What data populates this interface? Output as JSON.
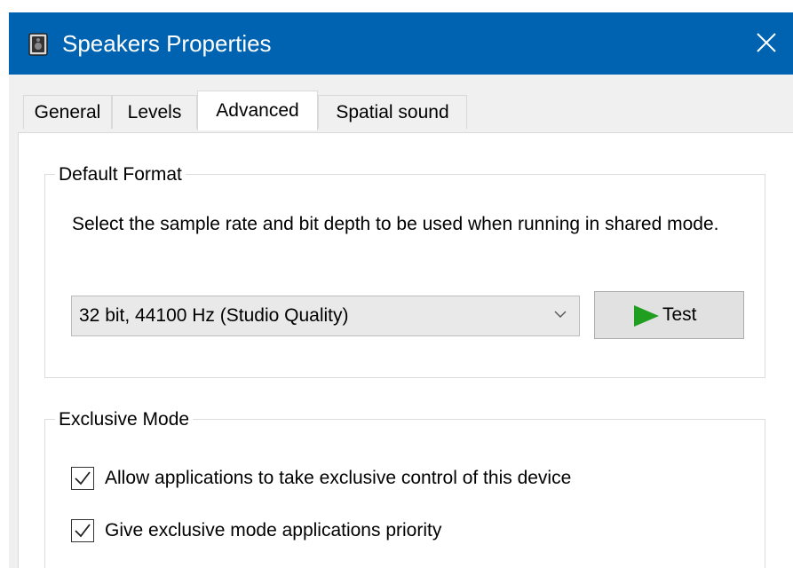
{
  "window": {
    "title": "Speakers Properties",
    "app_icon": "speaker-icon",
    "close_icon": "close-icon",
    "titlebar_color": "#0063b1"
  },
  "tabs": [
    {
      "label": "General",
      "active": false
    },
    {
      "label": "Levels",
      "active": false
    },
    {
      "label": "Advanced",
      "active": true
    },
    {
      "label": "Spatial sound",
      "active": false
    }
  ],
  "default_format": {
    "group_label": "Default Format",
    "description": "Select the sample rate and bit depth to be used when running in shared mode.",
    "selected_format": "32 bit, 44100 Hz (Studio Quality)",
    "test_label": "Test",
    "test_icon": "play-icon",
    "play_color": "#1f9e1f"
  },
  "exclusive_mode": {
    "group_label": "Exclusive Mode",
    "options": [
      {
        "label": "Allow applications to take exclusive control of this device",
        "checked": true
      },
      {
        "label": "Give exclusive mode applications priority",
        "checked": true
      }
    ]
  }
}
